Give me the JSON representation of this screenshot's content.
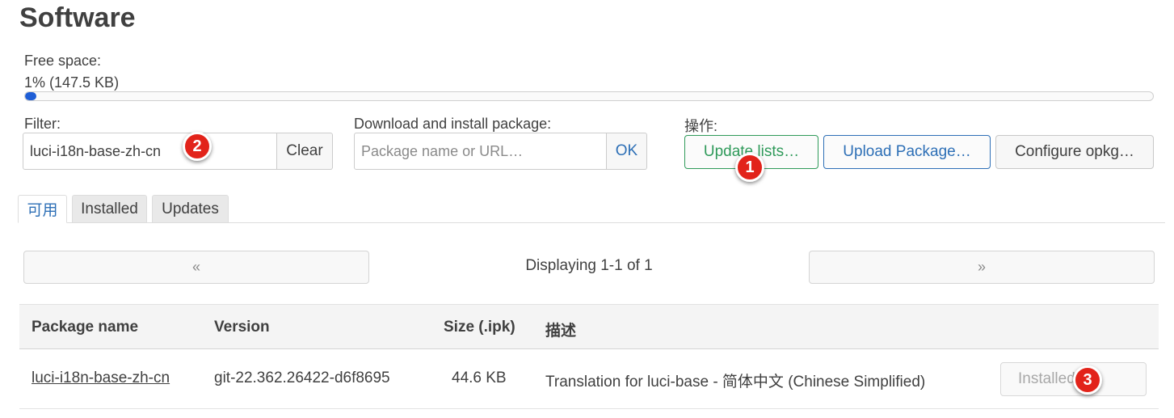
{
  "page": {
    "title": "Software"
  },
  "free_space": {
    "label": "Free space:",
    "value_text": "1% (147.5 KB)",
    "percent": 1
  },
  "filter": {
    "label": "Filter:",
    "value": "luci-i18n-base-zh-cn",
    "clear_label": "Clear"
  },
  "download": {
    "label": "Download and install package:",
    "placeholder": "Package name or URL…",
    "ok_label": "OK"
  },
  "actions": {
    "label": "操作:",
    "update_lists": "Update lists…",
    "upload_package": "Upload Package…",
    "configure_opkg": "Configure opkg…"
  },
  "tabs": [
    {
      "label": "可用",
      "active": true
    },
    {
      "label": "Installed",
      "active": false
    },
    {
      "label": "Updates",
      "active": false
    }
  ],
  "pager": {
    "prev": "«",
    "next": "»",
    "status": "Displaying 1-1 of 1"
  },
  "table": {
    "headers": [
      "Package name",
      "Version",
      "Size (.ipk)",
      "描述"
    ],
    "rows": [
      {
        "name": "luci-i18n-base-zh-cn",
        "version": "git-22.362.26422-d6f8695",
        "size": "44.6 KB",
        "description": "Translation for luci-base - 简体中文 (Chinese Simplified)",
        "action": "Installed"
      }
    ]
  },
  "badges": [
    "1",
    "2",
    "3"
  ],
  "colors": {
    "accent_blue": "#2d6fb6",
    "accent_green": "#2f9a5a",
    "badge_red": "#e2231a",
    "progress": "#1f5ed6"
  }
}
